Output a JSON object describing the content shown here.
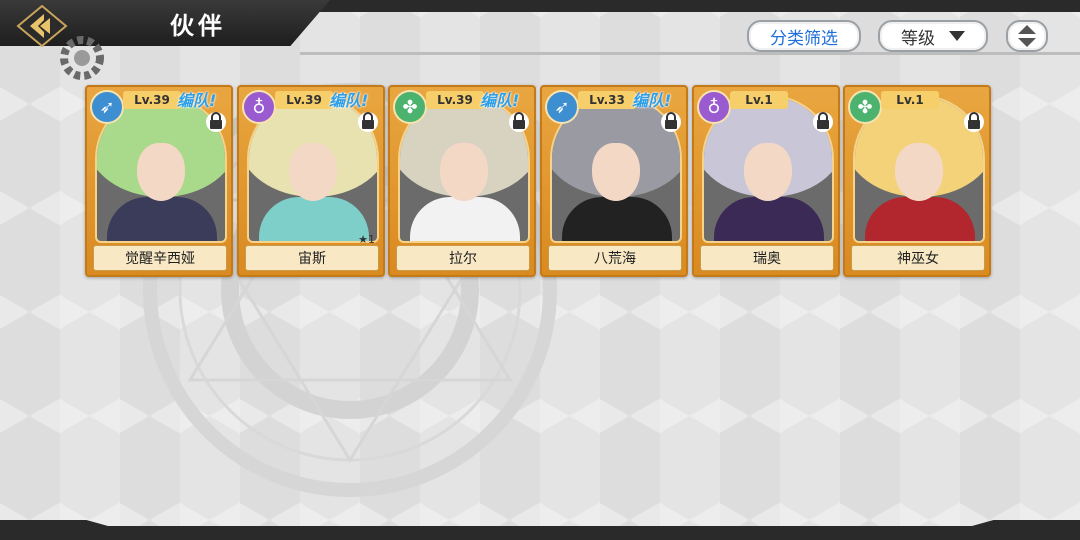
{
  "header": {
    "title": "伙伴",
    "filter_label": "分类筛选",
    "sort_label": "等级"
  },
  "companions": [
    {
      "name": "觉醒辛西娅",
      "level": "Lv.39",
      "team_tag": "编队!",
      "class_icon": "bow-icon",
      "class_color": "#3d8fd1",
      "hair": "#a9d98a",
      "outfit": "#3b3b5a",
      "star": ""
    },
    {
      "name": "宙斯",
      "level": "Lv.39",
      "team_tag": "编队!",
      "class_icon": "orb-icon",
      "class_color": "#9a5bd0",
      "hair": "#e8e2b0",
      "outfit": "#7ecfc9",
      "star": "1"
    },
    {
      "name": "拉尔",
      "level": "Lv.39",
      "team_tag": "编队!",
      "class_icon": "cross-icon",
      "class_color": "#4bb36e",
      "hair": "#d8d2c0",
      "outfit": "#f2f2f2",
      "star": ""
    },
    {
      "name": "八荒海",
      "level": "Lv.33",
      "team_tag": "编队!",
      "class_icon": "bow-icon",
      "class_color": "#3d8fd1",
      "hair": "#9a9aa2",
      "outfit": "#222",
      "star": ""
    },
    {
      "name": "瑞奥",
      "level": "Lv.1",
      "team_tag": "",
      "class_icon": "orb-icon",
      "class_color": "#9a5bd0",
      "hair": "#c9c6d8",
      "outfit": "#3b2a55",
      "star": ""
    },
    {
      "name": "神巫女",
      "level": "Lv.1",
      "team_tag": "",
      "class_icon": "cross-icon",
      "class_color": "#4bb36e",
      "hair": "#f3d27a",
      "outfit": "#b2272d",
      "star": ""
    }
  ]
}
